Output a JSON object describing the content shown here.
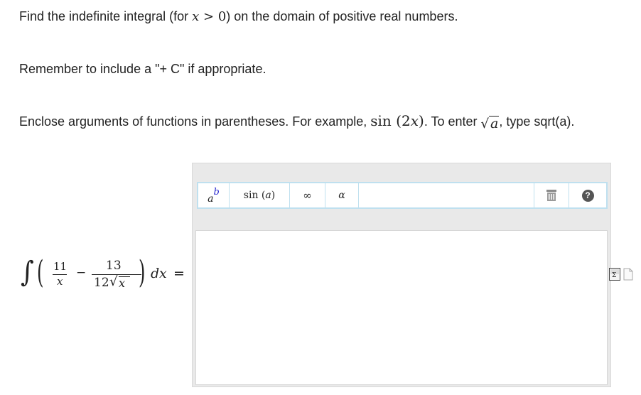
{
  "instructions": {
    "line1": {
      "pre": "Find the indefinite integral (for ",
      "var": "x",
      "op": " > ",
      "num": "0",
      "post": ") on the domain of positive real numbers."
    },
    "line2": "Remember to include a \"+ C\" if appropriate.",
    "line3": {
      "pre": "Enclose arguments of functions in parentheses. For example, ",
      "fn": "sin",
      "lp": " (",
      "coef": "2",
      "var": "x",
      "rp": ")",
      "mid": ". To enter ",
      "rad": "a",
      "post": ", type sqrt(a)."
    }
  },
  "integral": {
    "num1": "11",
    "den1": "x",
    "minus": "−",
    "num2": "13",
    "coef2": "12",
    "rad2": "x",
    "d": "d",
    "dvar": "x",
    "eq": "="
  },
  "toolbar": {
    "power_base": "a",
    "power_exp": "b",
    "sin_label": "sin",
    "sin_arg": "a",
    "infinity": "∞",
    "alpha": "α",
    "help": "?"
  },
  "answer": {
    "value": ""
  },
  "colors": {
    "toolbar_border": "#bfe0ef",
    "editor_bg": "#e9e9e9",
    "help_icon": "#555555",
    "power_exp": "#2b2bd0"
  }
}
